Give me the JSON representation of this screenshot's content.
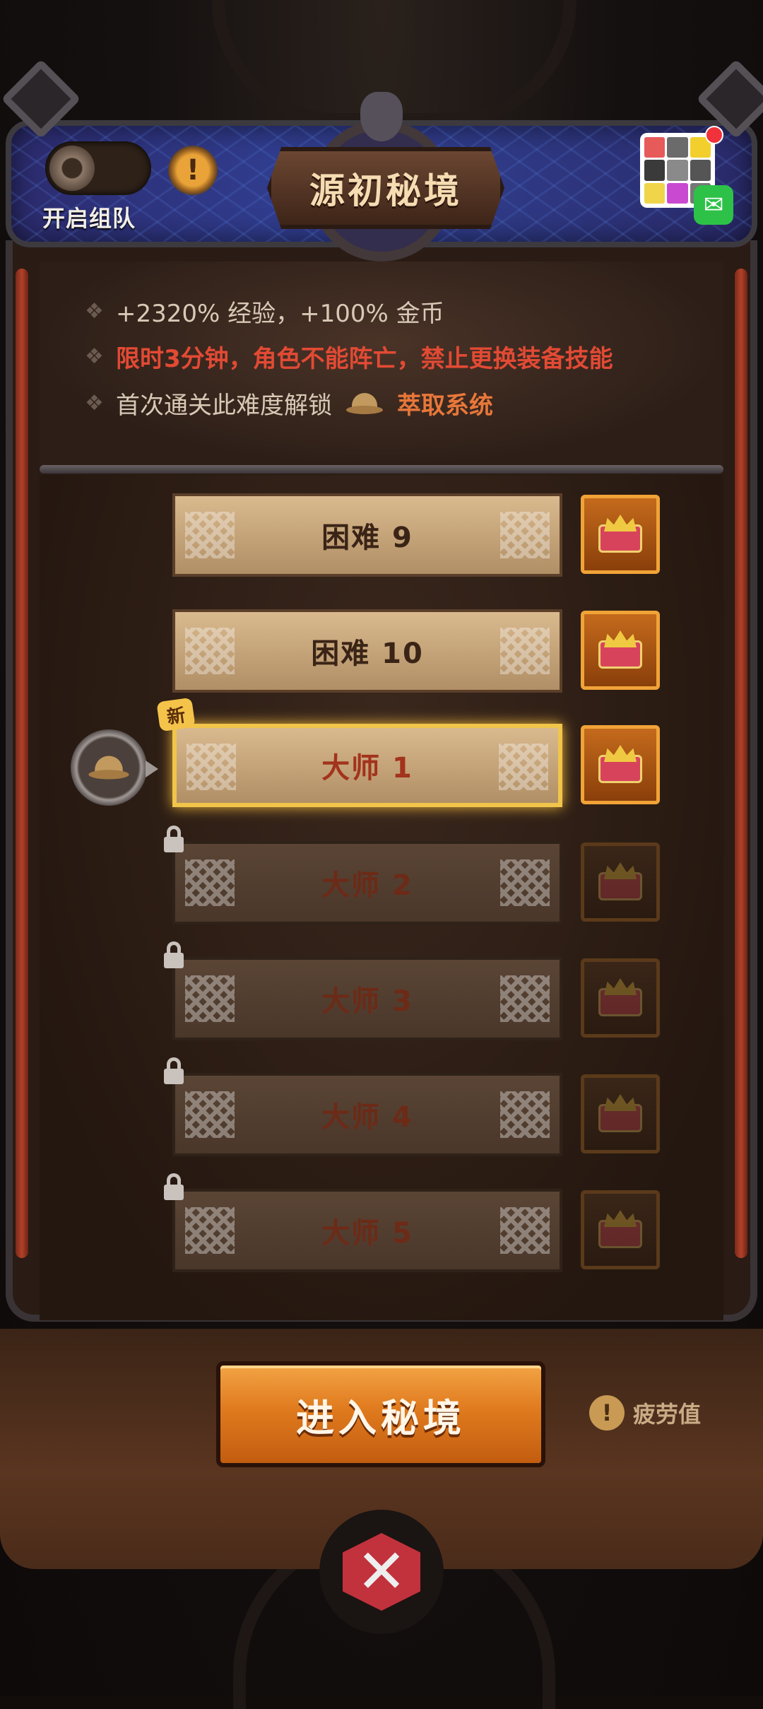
{
  "header": {
    "team_toggle_label": "开启组队",
    "title": "源初秘境"
  },
  "info": {
    "reward_line": "+2320% 经验，+100% 金币",
    "rule_line": "限时3分钟，角色不能阵亡，禁止更换装备技能",
    "unlock_prefix": "首次通关此难度解锁",
    "unlock_system": "萃取系统"
  },
  "difficulties": [
    {
      "label": "困难 9",
      "state": "unlocked"
    },
    {
      "label": "困难 10",
      "state": "unlocked"
    },
    {
      "label": "大师 1",
      "state": "current",
      "badge": "新"
    },
    {
      "label": "大师 2",
      "state": "locked"
    },
    {
      "label": "大师 3",
      "state": "locked"
    },
    {
      "label": "大师 4",
      "state": "locked"
    },
    {
      "label": "大师 5",
      "state": "locked"
    }
  ],
  "footer": {
    "enter_button": "进入秘境",
    "fatigue_label": "疲劳值",
    "close_icon": "crossed-swords-icon"
  },
  "icons": {
    "bullet": "❖",
    "info": "!",
    "wechat": "wechat-icon"
  },
  "colors": {
    "accent_orange": "#e07a1e",
    "rule_red": "#e24a34",
    "current_gold": "#f0c54a"
  }
}
